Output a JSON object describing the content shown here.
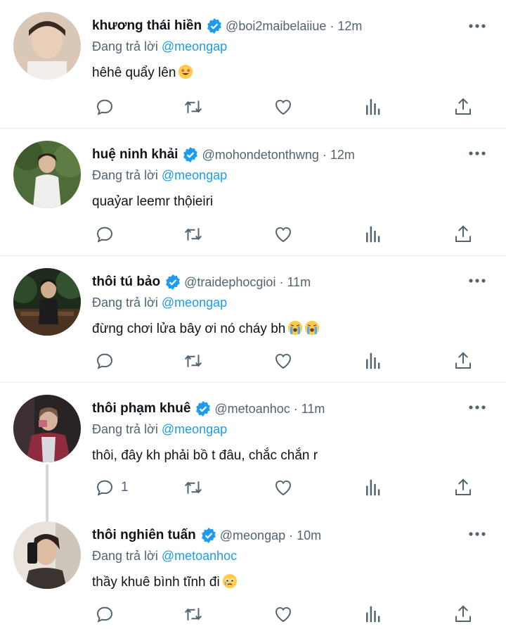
{
  "tweets": [
    {
      "name": "khương thái hiền",
      "handle": "@boi2maibelaiiue",
      "time": "12m",
      "replying_prefix": "Đang trả lời",
      "replying_to": "@meongap",
      "text": "hêhê quẩy lên",
      "emoji": [
        "star-struck-emoji"
      ],
      "reply_count": ""
    },
    {
      "name": "huệ ninh khải",
      "handle": "@mohondetonthwng",
      "time": "12m",
      "replying_prefix": "Đang trả lời",
      "replying_to": "@meongap",
      "text": "quaỷar leemr thộieiri",
      "emoji": [],
      "reply_count": ""
    },
    {
      "name": "thôi tú bảo",
      "handle": "@traidephocgioi",
      "time": "11m",
      "replying_prefix": "Đang trả lời",
      "replying_to": "@meongap",
      "text": "đừng chơi lửa bây ơi nó cháy bh",
      "emoji": [
        "loudly-crying-emoji",
        "loudly-crying-emoji"
      ],
      "reply_count": ""
    },
    {
      "name": "thôi phạm khuê",
      "handle": "@metoanhoc",
      "time": "11m",
      "replying_prefix": "Đang trả lời",
      "replying_to": "@meongap",
      "text": "thôi, đây kh phải bồ t đâu, chắc chắn r",
      "emoji": [],
      "reply_count": "1"
    },
    {
      "name": "thôi nghiên tuấn",
      "handle": "@meongap",
      "time": "10m",
      "replying_prefix": "Đang trả lời",
      "replying_to": "@metoanhoc",
      "text": "thầy khuê bình tĩnh đi",
      "emoji": [
        "holding-back-tears-emoji"
      ],
      "reply_count": ""
    }
  ],
  "colors": {
    "accent": "#1d9bf0",
    "text": "#0f1419",
    "muted": "#536471",
    "divider": "#e6ecf0"
  },
  "icons": [
    "verified-badge-icon",
    "more-icon",
    "reply-icon",
    "retweet-icon",
    "like-icon",
    "views-icon",
    "share-icon"
  ]
}
